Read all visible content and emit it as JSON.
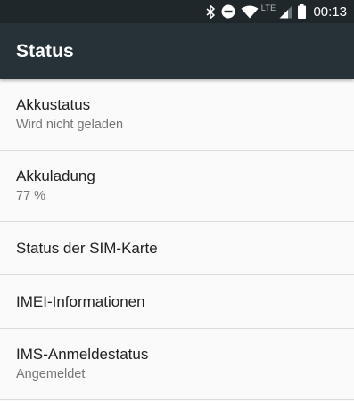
{
  "status_bar": {
    "network_type": "LTE",
    "time": "00:13",
    "icons": [
      "bluetooth-icon",
      "do-not-disturb-icon",
      "wifi-icon",
      "cell-signal-icon",
      "battery-icon"
    ]
  },
  "app_bar": {
    "title": "Status"
  },
  "items": [
    {
      "title": "Akkustatus",
      "summary": "Wird nicht geladen"
    },
    {
      "title": "Akkuladung",
      "summary": "77 %"
    },
    {
      "title": "Status der SIM-Karte"
    },
    {
      "title": "IMEI-Informationen"
    },
    {
      "title": "IMS-Anmeldestatus",
      "summary": "Angemeldet"
    }
  ],
  "colors": {
    "status_bar_bg": "#1f272b",
    "app_bar_bg": "#263238",
    "list_bg": "#fafafa",
    "primary_text": "#212121",
    "secondary_text": "#757575",
    "divider": "#dcdcdc"
  }
}
